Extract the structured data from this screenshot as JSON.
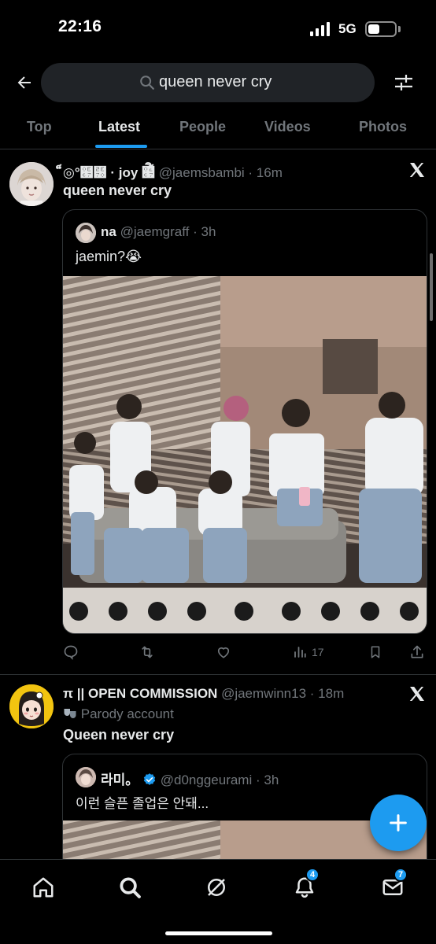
{
  "status_bar": {
    "time": "22:16",
    "network": "5G"
  },
  "search": {
    "query": "queen never cry"
  },
  "tabs": [
    {
      "label": "Top"
    },
    {
      "label": "Latest"
    },
    {
      "label": "People"
    },
    {
      "label": "Videos"
    },
    {
      "label": "Photos"
    }
  ],
  "active_tab": "Latest",
  "tweets": [
    {
      "display_name": "็◎°๧⹰ · joy ๧็ิ",
      "handle": "@jaemsbambi",
      "time": "16m",
      "text": "queen never cry",
      "quote": {
        "display_name": "na",
        "handle": "@jaemgraff",
        "time": "3h",
        "text": "jaemin?😭"
      },
      "actions": {
        "views": "17"
      }
    },
    {
      "display_name": "π || OPEN COMMISSION",
      "handle": "@jaemwinn13",
      "time": "18m",
      "parody_label": "Parody account",
      "text": "Queen never cry",
      "quote": {
        "display_name": "라미。",
        "handle": "@d0nggeurami",
        "time": "3h",
        "text": "이런 슬픈 졸업은 안돼..."
      }
    }
  ],
  "bottom_nav": {
    "notifications_badge": "4",
    "messages_badge": "7"
  },
  "colors": {
    "accent": "#1d9bf0",
    "background": "#000000",
    "secondary_text": "#71767b",
    "divider": "#2f3336"
  }
}
